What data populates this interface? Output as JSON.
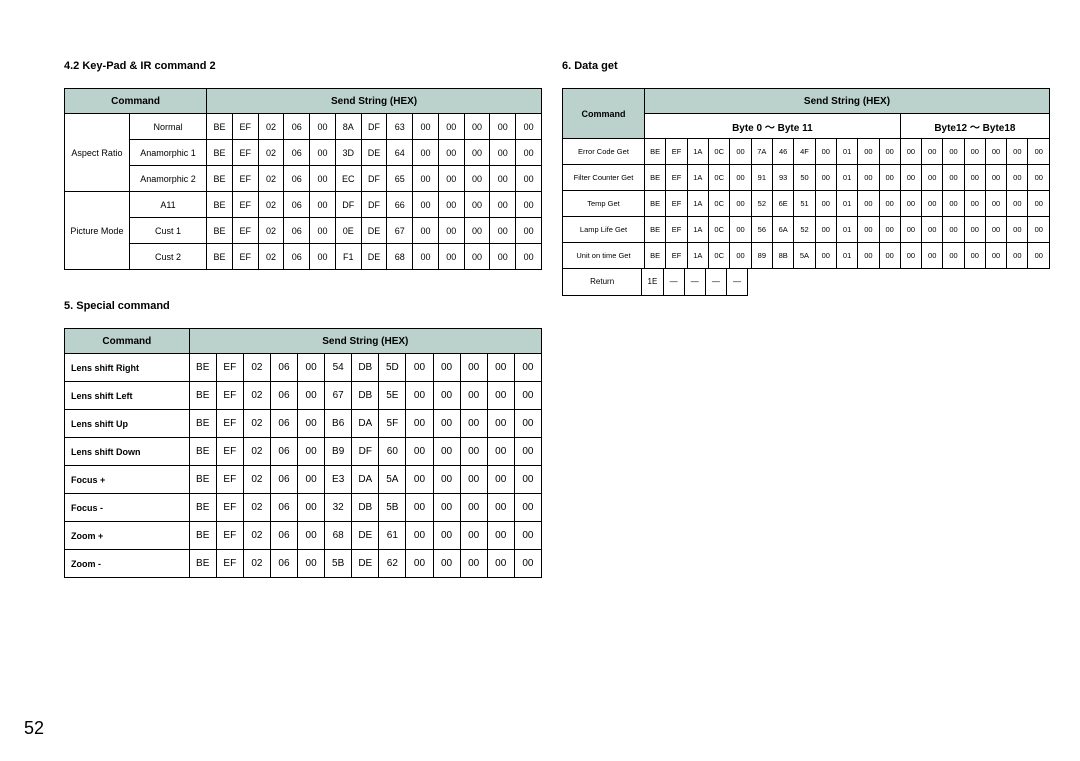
{
  "page_number": "52",
  "section1": {
    "title": "4.2 Key-Pad & IR command 2",
    "hdr_command": "Command",
    "hdr_send": "Send String (HEX)",
    "rows": [
      {
        "cat": "Aspect Ratio",
        "name": "Normal",
        "hex": [
          "BE",
          "EF",
          "02",
          "06",
          "00",
          "8A",
          "DF",
          "63",
          "00",
          "00",
          "00",
          "00",
          "00"
        ]
      },
      {
        "cat": "",
        "name": "Anamorphic 1",
        "hex": [
          "BE",
          "EF",
          "02",
          "06",
          "00",
          "3D",
          "DE",
          "64",
          "00",
          "00",
          "00",
          "00",
          "00"
        ]
      },
      {
        "cat": "",
        "name": "Anamorphic 2",
        "hex": [
          "BE",
          "EF",
          "02",
          "06",
          "00",
          "EC",
          "DF",
          "65",
          "00",
          "00",
          "00",
          "00",
          "00"
        ]
      },
      {
        "cat": "Picture Mode",
        "name": "A11",
        "hex": [
          "BE",
          "EF",
          "02",
          "06",
          "00",
          "DF",
          "DF",
          "66",
          "00",
          "00",
          "00",
          "00",
          "00"
        ]
      },
      {
        "cat": "",
        "name": "Cust 1",
        "hex": [
          "BE",
          "EF",
          "02",
          "06",
          "00",
          "0E",
          "DE",
          "67",
          "00",
          "00",
          "00",
          "00",
          "00"
        ]
      },
      {
        "cat": "",
        "name": "Cust 2",
        "hex": [
          "BE",
          "EF",
          "02",
          "06",
          "00",
          "F1",
          "DE",
          "68",
          "00",
          "00",
          "00",
          "00",
          "00"
        ]
      }
    ]
  },
  "section2": {
    "title": "5. Special command",
    "hdr_command": "Command",
    "hdr_send": "Send String (HEX)",
    "rows": [
      {
        "name": "Lens shift  Right",
        "hex": [
          "BE",
          "EF",
          "02",
          "06",
          "00",
          "54",
          "DB",
          "5D",
          "00",
          "00",
          "00",
          "00",
          "00"
        ]
      },
      {
        "name": "Lens shift  Left",
        "hex": [
          "BE",
          "EF",
          "02",
          "06",
          "00",
          "67",
          "DB",
          "5E",
          "00",
          "00",
          "00",
          "00",
          "00"
        ]
      },
      {
        "name": "Lens shift  Up",
        "hex": [
          "BE",
          "EF",
          "02",
          "06",
          "00",
          "B6",
          "DA",
          "5F",
          "00",
          "00",
          "00",
          "00",
          "00"
        ]
      },
      {
        "name": "Lens shift  Down",
        "hex": [
          "BE",
          "EF",
          "02",
          "06",
          "00",
          "B9",
          "DF",
          "60",
          "00",
          "00",
          "00",
          "00",
          "00"
        ]
      },
      {
        "name": "Focus +",
        "hex": [
          "BE",
          "EF",
          "02",
          "06",
          "00",
          "E3",
          "DA",
          "5A",
          "00",
          "00",
          "00",
          "00",
          "00"
        ]
      },
      {
        "name": "Focus -",
        "hex": [
          "BE",
          "EF",
          "02",
          "06",
          "00",
          "32",
          "DB",
          "5B",
          "00",
          "00",
          "00",
          "00",
          "00"
        ]
      },
      {
        "name": "Zoom +",
        "hex": [
          "BE",
          "EF",
          "02",
          "06",
          "00",
          "68",
          "DE",
          "61",
          "00",
          "00",
          "00",
          "00",
          "00"
        ]
      },
      {
        "name": "Zoom -",
        "hex": [
          "BE",
          "EF",
          "02",
          "06",
          "00",
          "5B",
          "DE",
          "62",
          "00",
          "00",
          "00",
          "00",
          "00"
        ]
      }
    ]
  },
  "section3": {
    "title": "6. Data get",
    "hdr_command": "Command",
    "hdr_send": "Send String (HEX)",
    "hdr_byte0": "Byte 0 ～ Byte 11",
    "hdr_byte12": "Byte12 ～ Byte18",
    "rows": [
      {
        "name": "Error Code Get",
        "hex": [
          "BE",
          "EF",
          "1A",
          "0C",
          "00",
          "7A",
          "46",
          "4F",
          "00",
          "01",
          "00",
          "00",
          "00",
          "00",
          "00",
          "00",
          "00",
          "00",
          "00"
        ]
      },
      {
        "name": "Filter Counter Get",
        "hex": [
          "BE",
          "EF",
          "1A",
          "0C",
          "00",
          "91",
          "93",
          "50",
          "00",
          "01",
          "00",
          "00",
          "00",
          "00",
          "00",
          "00",
          "00",
          "00",
          "00"
        ]
      },
      {
        "name": "Temp Get",
        "hex": [
          "BE",
          "EF",
          "1A",
          "0C",
          "00",
          "52",
          "6E",
          "51",
          "00",
          "01",
          "00",
          "00",
          "00",
          "00",
          "00",
          "00",
          "00",
          "00",
          "00"
        ]
      },
      {
        "name": "Lamp Life Get",
        "hex": [
          "BE",
          "EF",
          "1A",
          "0C",
          "00",
          "56",
          "6A",
          "52",
          "00",
          "01",
          "00",
          "00",
          "00",
          "00",
          "00",
          "00",
          "00",
          "00",
          "00"
        ]
      },
      {
        "name": "Unit on time Get",
        "hex": [
          "BE",
          "EF",
          "1A",
          "0C",
          "00",
          "89",
          "8B",
          "5A",
          "00",
          "01",
          "00",
          "00",
          "00",
          "00",
          "00",
          "00",
          "00",
          "00",
          "00"
        ]
      }
    ],
    "return_label": "Return",
    "return_hex": [
      "1E",
      "—",
      "—",
      "—",
      "—"
    ]
  }
}
